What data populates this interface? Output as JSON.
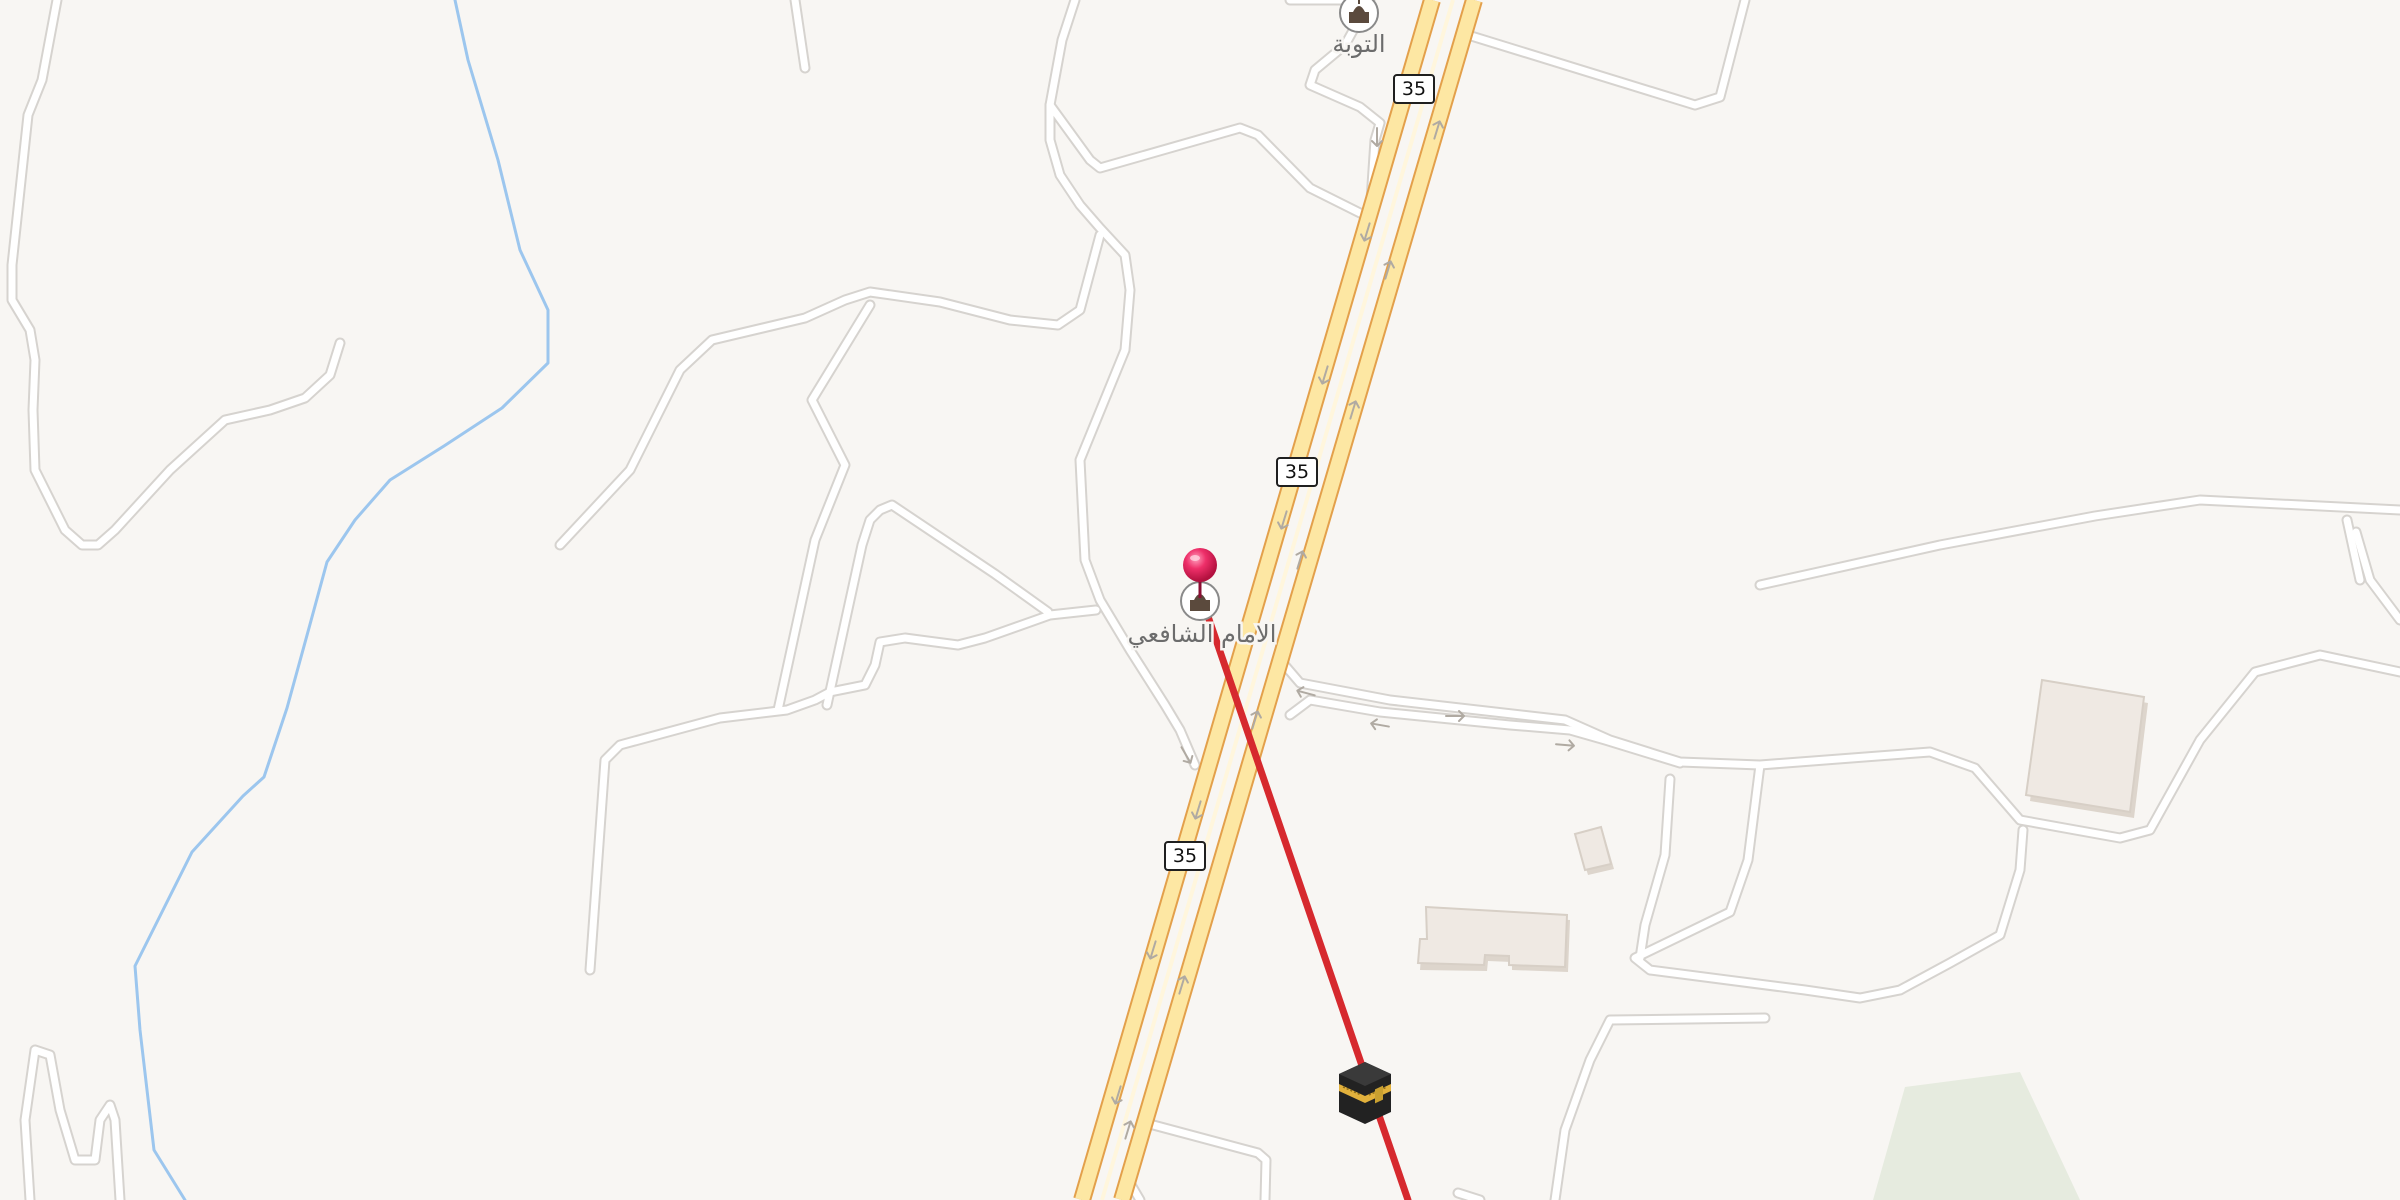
{
  "map": {
    "route_shields": [
      "35",
      "35",
      "35"
    ],
    "poi_labels": {
      "mosque_top": "التوبة",
      "mosque_center": "الامام الشافعي"
    },
    "icons": {
      "location_pin": "location-pin-icon",
      "mosque": "mosque-icon",
      "kaaba": "kaaba-icon",
      "one_way_arrow": "one-way-arrow-icon"
    },
    "colors": {
      "background": "#f8f6f3",
      "highway_fill": "#fde7a3",
      "highway_casing": "#e3a04b",
      "qibla_line": "#d6292e",
      "pin": "#e8285f",
      "river": "#9cc6ee",
      "park": "#e6ebdf"
    }
  }
}
